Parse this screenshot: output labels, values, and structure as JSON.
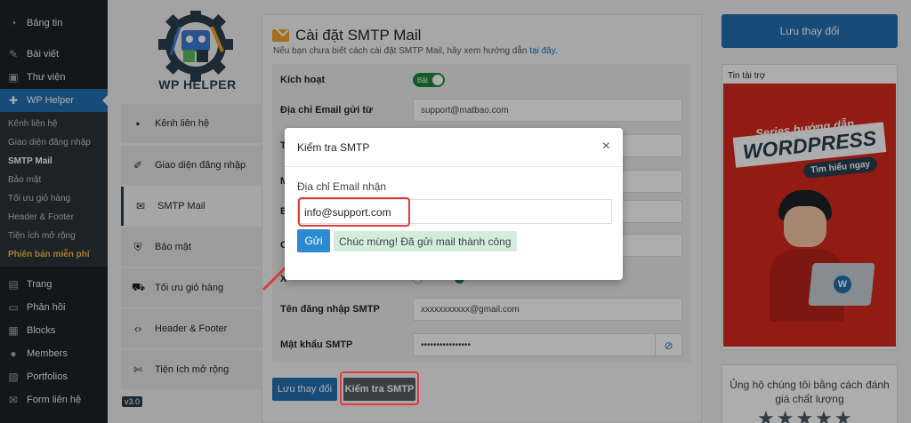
{
  "admin_menu": {
    "top_items": [
      {
        "label": "Bảng tin",
        "icon": "dashboard-icon",
        "glyph": "◔"
      },
      {
        "label": "Bài viết",
        "icon": "pin-icon",
        "glyph": "✎"
      },
      {
        "label": "Thư viện",
        "icon": "media-icon",
        "glyph": "▣"
      },
      {
        "label": "WP Helper",
        "icon": "plugin-icon",
        "glyph": "✚"
      }
    ],
    "submenu": [
      "Kênh liên hệ",
      "Giao diện đăng nhập",
      "SMTP Mail",
      "Bảo mật",
      "Tối ưu giỏ hàng",
      "Header & Footer",
      "Tiện ích mở rộng",
      "Phiên bản miễn phí"
    ],
    "bottom_items": [
      {
        "label": "Trang",
        "icon": "page-icon",
        "glyph": "▤"
      },
      {
        "label": "Phản hồi",
        "icon": "comment-icon",
        "glyph": "▭"
      },
      {
        "label": "Blocks",
        "icon": "blocks-icon",
        "glyph": "▦"
      },
      {
        "label": "Members",
        "icon": "users-icon",
        "glyph": "●"
      },
      {
        "label": "Portfolios",
        "icon": "portfolio-icon",
        "glyph": "▧"
      },
      {
        "label": "Form liên hệ",
        "icon": "mail-icon",
        "glyph": "✉"
      }
    ]
  },
  "plugin": {
    "logo_text": "WP HELPER",
    "nav": [
      {
        "label": "Kênh liên hệ",
        "icon": "chat-icon",
        "glyph": "▪"
      },
      {
        "label": "Giao diện đăng nhập",
        "icon": "brush-icon",
        "glyph": "✐"
      },
      {
        "label": "SMTP Mail",
        "icon": "envelope-icon",
        "glyph": "✉"
      },
      {
        "label": "Bảo mật",
        "icon": "shield-icon",
        "glyph": "⛨"
      },
      {
        "label": "Tối ưu giỏ hàng",
        "icon": "cart-icon",
        "glyph": "⛟"
      },
      {
        "label": "Header & Footer",
        "icon": "code-icon",
        "glyph": "‹›"
      },
      {
        "label": "Tiện ích mở rộng",
        "icon": "tools-icon",
        "glyph": "✄"
      }
    ],
    "version": "v3.0"
  },
  "settings": {
    "title": "Cài đặt SMTP Mail",
    "subtitle": "Nếu bạn chưa biết cách cài đặt SMTP Mail, hãy xem hướng dẫn",
    "subtitle_link": "tại đây",
    "subtitle_end": ".",
    "enable_label": "Kích hoạt",
    "toggle_label": "Bật",
    "from_email_label": "Địa chỉ Email gửi từ",
    "from_email_value": "support@matbao.com",
    "hidden_rows": [
      "Tê",
      "M",
      "B",
      "C",
      "X"
    ],
    "username_label": "Tên đăng nhập SMTP",
    "username_value": "xxxxxxxxxxx@gmail.com",
    "password_label": "Mật khẩu SMTP",
    "password_value": "••••••••••••••••",
    "save_label": "Lưu thay đổi",
    "test_label": "Kiểm tra SMTP"
  },
  "right": {
    "save_label": "Lưu thay đổi",
    "sponsor_label": "Tin tài trợ",
    "banner_series": "Series hướng dẫn",
    "banner_wp": "WORDPRESS",
    "banner_more": "Tìm hiểu ngay",
    "support_text": "Ủng hộ chúng tôi bằng cách đánh giá chất lượng",
    "stars": "★★★★★"
  },
  "modal": {
    "title": "Kiểm tra SMTP",
    "close": "×",
    "label": "Địa chỉ Email nhận",
    "email_value": "info@support.com",
    "send_label": "Gửi",
    "success": "Chúc mừng! Đã gửi mail thành công"
  },
  "colors": {
    "accent": "#2271b1",
    "highlight": "#e03b3b",
    "success_bg": "#d4edda",
    "promo": "#f0b849"
  }
}
